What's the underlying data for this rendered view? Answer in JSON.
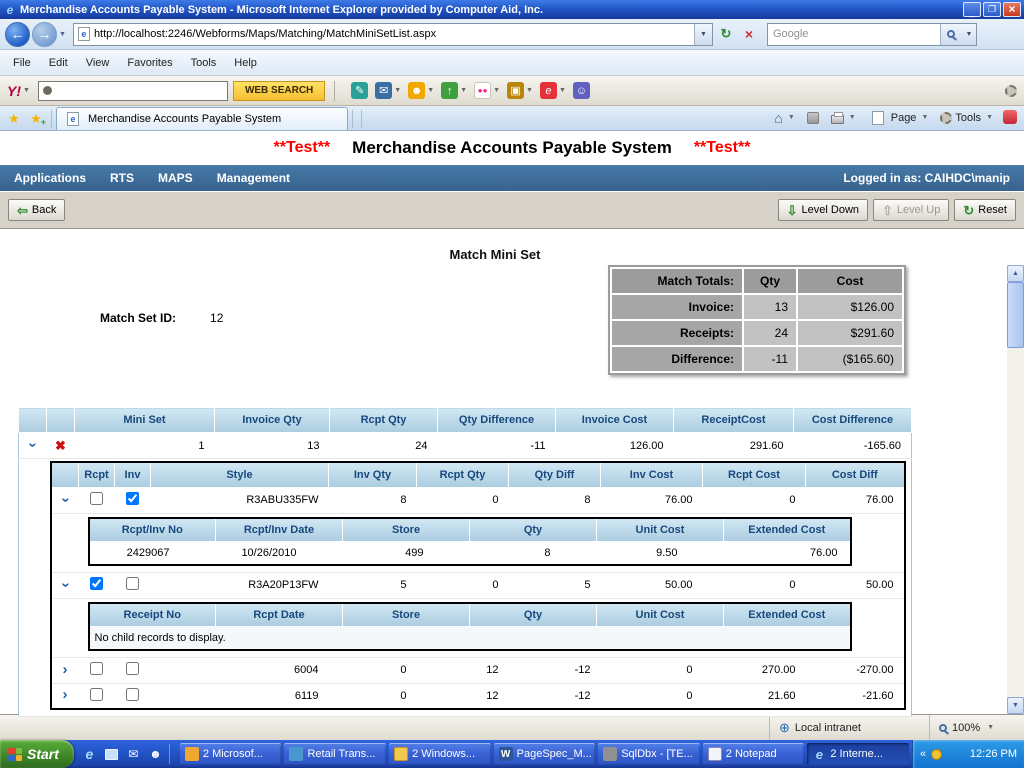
{
  "titlebar": {
    "title": "Merchandise Accounts Payable System - Microsoft Internet Explorer provided by Computer Aid, Inc."
  },
  "addressbar": {
    "url": "http://localhost:2246/Webforms/Maps/Matching/MatchMiniSetList.aspx",
    "search_placeholder": "Google"
  },
  "menubar": {
    "items": [
      "File",
      "Edit",
      "View",
      "Favorites",
      "Tools",
      "Help"
    ]
  },
  "yahoo_toolbar": {
    "logo": "Y!",
    "web_search_label": "WEB SEARCH"
  },
  "tabbar": {
    "tab_title": "Merchandise Accounts Payable System",
    "page_label": "Page",
    "tools_label": "Tools"
  },
  "app": {
    "test_marker": "**Test**",
    "title": "Merchandise Accounts Payable System",
    "nav_items": [
      "Applications",
      "RTS",
      "MAPS",
      "Management"
    ],
    "logged_in": "Logged in as: CAIHDC\\manip",
    "toolbar": {
      "back": "Back",
      "level_down": "Level Down",
      "level_up": "Level Up",
      "reset": "Reset"
    },
    "heading": "Match Mini Set",
    "match_set_id_label": "Match Set ID:",
    "match_set_id_value": "12",
    "totals": {
      "headers": [
        "Match Totals:",
        "Qty",
        "Cost"
      ],
      "rows": [
        {
          "label": "Invoice:",
          "qty": "13",
          "cost": "$126.00"
        },
        {
          "label": "Receipts:",
          "qty": "24",
          "cost": "$291.60"
        },
        {
          "label": "Difference:",
          "qty": "-11",
          "cost": "($165.60)"
        }
      ]
    },
    "grid": {
      "headers": [
        "Mini Set",
        "Invoice Qty",
        "Rcpt Qty",
        "Qty Difference",
        "Invoice Cost",
        "ReceiptCost",
        "Cost Difference"
      ],
      "row1": {
        "mini_set": "1",
        "invoice_qty": "13",
        "rcpt_qty": "24",
        "qty_difference": "-11",
        "invoice_cost": "126.00",
        "receipt_cost": "291.60",
        "cost_difference": "-165.60"
      }
    },
    "inner_grid": {
      "headers": [
        "Rcpt",
        "Inv",
        "Style",
        "Inv Qty",
        "Rcpt Qty",
        "Qty Diff",
        "Inv Cost",
        "Rcpt Cost",
        "Cost Diff"
      ],
      "rows": [
        {
          "style": "R3ABU335FW",
          "inv_qty": "8",
          "rcpt_qty": "0",
          "qty_diff": "8",
          "inv_cost": "76.00",
          "rcpt_cost": "0",
          "cost_diff": "76.00",
          "rcpt_checked": false,
          "inv_checked": true
        },
        {
          "style": "R3A20P13FW",
          "inv_qty": "5",
          "rcpt_qty": "0",
          "qty_diff": "5",
          "inv_cost": "50.00",
          "rcpt_cost": "0",
          "cost_diff": "50.00",
          "rcpt_checked": true,
          "inv_checked": false
        },
        {
          "style": "6004",
          "inv_qty": "0",
          "rcpt_qty": "12",
          "qty_diff": "-12",
          "inv_cost": "0",
          "rcpt_cost": "270.00",
          "cost_diff": "-270.00",
          "rcpt_checked": false,
          "inv_checked": false
        },
        {
          "style": "6119",
          "inv_qty": "0",
          "rcpt_qty": "12",
          "qty_diff": "-12",
          "inv_cost": "0",
          "rcpt_cost": "21.60",
          "cost_diff": "-21.60",
          "rcpt_checked": false,
          "inv_checked": false
        }
      ]
    },
    "detail1": {
      "headers": [
        "Rcpt/Inv No",
        "Rcpt/Inv Date",
        "Store",
        "Qty",
        "Unit Cost",
        "Extended Cost"
      ],
      "row": {
        "no": "2429067",
        "date": "10/26/2010",
        "store": "499",
        "qty": "8",
        "unit_cost": "9.50",
        "extended_cost": "76.00"
      }
    },
    "detail2": {
      "headers": [
        "Receipt No",
        "Rcpt Date",
        "Store",
        "Qty",
        "Unit Cost",
        "Extended Cost"
      ],
      "empty_message": "No child records to display."
    }
  },
  "statusbar": {
    "zone": "Local intranet",
    "zoom": "100%"
  },
  "taskbar": {
    "start_label": "Start",
    "tasks": [
      {
        "label": "2 Microsof..."
      },
      {
        "label": "Retail Trans..."
      },
      {
        "label": "2 Windows..."
      },
      {
        "label": "PageSpec_M..."
      },
      {
        "label": "SqlDbx - [TE..."
      },
      {
        "label": "2 Notepad"
      },
      {
        "label": "2 Interne..."
      }
    ],
    "time": "12:26 PM"
  },
  "icons": {
    "ie": "e",
    "minimize": "_",
    "maximize": "❐",
    "close": "×",
    "back_arrow": "←",
    "forward_arrow": "→",
    "dropdown": "▼",
    "refresh": "↻",
    "stop": "×",
    "star": "★",
    "plus": "+",
    "home": "⌂",
    "pencil": "✎",
    "mail": "✉",
    "smiley": "☻",
    "up": "↑",
    "dots": "●●",
    "apps": "▣",
    "person": "☺",
    "globe": "⊕",
    "chevron": "›",
    "delete": "✖",
    "back_nav": "⇦",
    "level_down": "⇩",
    "level_up": "⇧",
    "reset": "↻",
    "overflow": "«"
  }
}
